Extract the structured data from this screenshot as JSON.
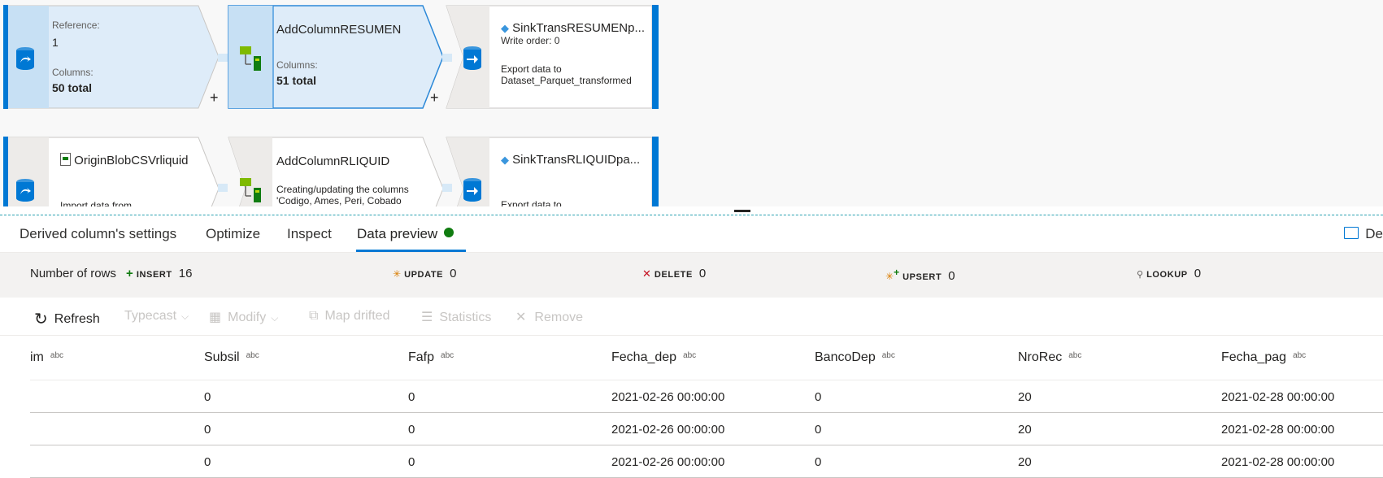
{
  "canvas": {
    "row1": {
      "source": {
        "ref_label": "Reference:",
        "ref_value": "1",
        "cols_label": "Columns:",
        "cols_value": "50 total"
      },
      "derive": {
        "title": "AddColumnRESUMEN",
        "cols_label": "Columns:",
        "cols_value": "51 total"
      },
      "sink": {
        "title": "SinkTransRESUMENp...",
        "order": "Write order: 0",
        "desc_line1": "Export data to",
        "desc_line2": "Dataset_Parquet_transformed"
      }
    },
    "row2": {
      "source": {
        "title": "OriginBlobCSVrliquid",
        "desc": "Import data from"
      },
      "derive": {
        "title": "AddColumnRLIQUID",
        "desc_line1": "Creating/updating the columns",
        "desc_line2": "'Codigo, Ames, Peri, Cobado"
      },
      "sink": {
        "title": "SinkTransRLIQUIDpa...",
        "desc": "Export data to"
      }
    },
    "plus": "+"
  },
  "tabs": {
    "items": [
      {
        "label": "Derived column's settings"
      },
      {
        "label": "Optimize"
      },
      {
        "label": "Inspect"
      },
      {
        "label": "Data preview"
      }
    ],
    "description": "De"
  },
  "counts": {
    "label": "Number of rows",
    "insert": {
      "key": "INSERT",
      "value": "16"
    },
    "update": {
      "key": "UPDATE",
      "value": "0"
    },
    "delete": {
      "key": "DELETE",
      "value": "0"
    },
    "upsert": {
      "key": "UPSERT",
      "value": "0"
    },
    "lookup": {
      "key": "LOOKUP",
      "value": "0"
    }
  },
  "toolbar": {
    "refresh": "Refresh",
    "typecast": "Typecast",
    "modify": "Modify",
    "map_drifted": "Map drifted",
    "statistics": "Statistics",
    "remove": "Remove"
  },
  "table": {
    "type_tag": "abc",
    "columns": [
      "im",
      "Subsil",
      "Fafp",
      "Fecha_dep",
      "BancoDep",
      "NroRec",
      "Fecha_pag"
    ],
    "rows": [
      [
        "",
        "0",
        "0",
        "2021-02-26 00:00:00",
        "0",
        "20",
        "2021-02-28 00:00:00"
      ],
      [
        "",
        "0",
        "0",
        "2021-02-26 00:00:00",
        "0",
        "20",
        "2021-02-28 00:00:00"
      ],
      [
        "",
        "0",
        "0",
        "2021-02-26 00:00:00",
        "0",
        "20",
        "2021-02-28 00:00:00"
      ]
    ]
  },
  "colors": {
    "accent": "#0078d4",
    "node_selected_fill": "#deecf9",
    "node_border": "#2b88d8",
    "status_green": "#107c10",
    "update_orange": "#d97d00",
    "delete_red": "#c50f1f"
  }
}
